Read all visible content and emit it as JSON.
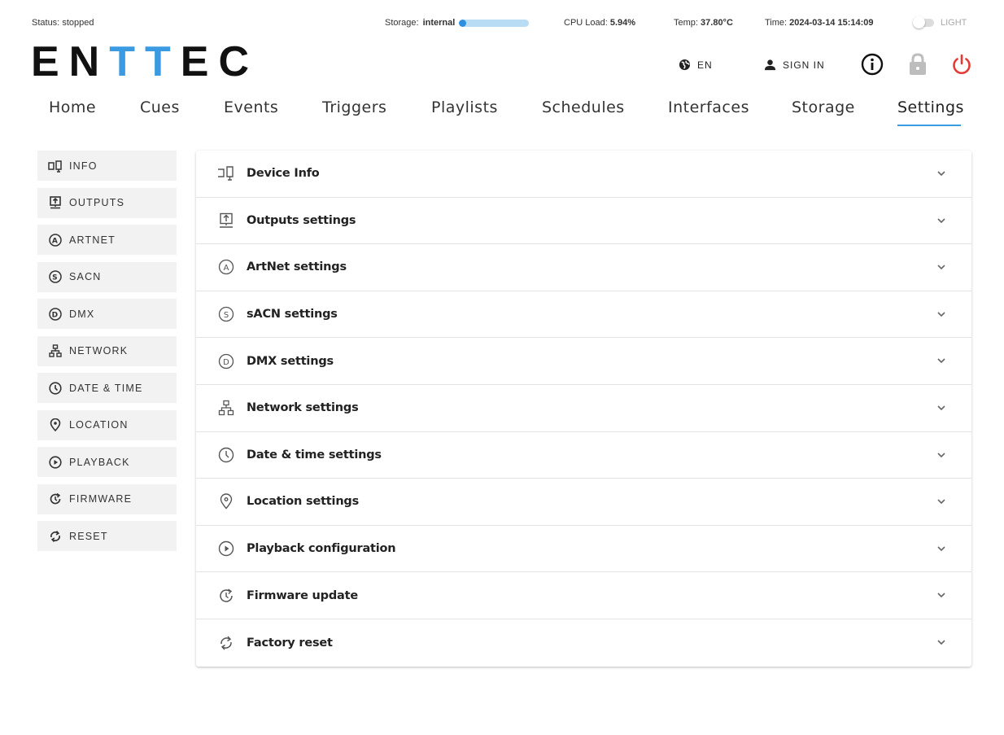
{
  "status_bar": {
    "status_label": "Status:",
    "status_value": "stopped",
    "storage_label": "Storage:",
    "storage_value": "internal",
    "storage_used_fraction": 0.1,
    "cpu_label": "CPU Load:",
    "cpu_value": "5.94%",
    "temp_label": "Temp:",
    "temp_value": "37.80°C",
    "time_label": "Time:",
    "time_value": "2024-03-14 15:14:09",
    "theme_label": "LIGHT"
  },
  "brand": {
    "part1": "EN",
    "part2": "TT",
    "part3": "EC"
  },
  "header": {
    "language": "EN",
    "sign_in": "SIGN IN",
    "icons": [
      "globe-icon",
      "person-icon",
      "info-icon",
      "lock-icon",
      "power-icon"
    ]
  },
  "nav": {
    "tabs": [
      {
        "label": "Home"
      },
      {
        "label": "Cues"
      },
      {
        "label": "Events"
      },
      {
        "label": "Triggers"
      },
      {
        "label": "Playlists"
      },
      {
        "label": "Schedules"
      },
      {
        "label": "Interfaces"
      },
      {
        "label": "Storage"
      },
      {
        "label": "Settings"
      }
    ],
    "active": "Settings"
  },
  "sidebar": {
    "items": [
      {
        "label": "INFO",
        "icon": "device-icon"
      },
      {
        "label": "OUTPUTS",
        "icon": "outputs-icon"
      },
      {
        "label": "ARTNET",
        "icon": "artnet-icon"
      },
      {
        "label": "SACN",
        "icon": "sacn-icon"
      },
      {
        "label": "DMX",
        "icon": "dmx-icon"
      },
      {
        "label": "NETWORK",
        "icon": "network-icon"
      },
      {
        "label": "DATE & TIME",
        "icon": "clock-icon"
      },
      {
        "label": "LOCATION",
        "icon": "location-icon"
      },
      {
        "label": "PLAYBACK",
        "icon": "play-icon"
      },
      {
        "label": "FIRMWARE",
        "icon": "update-icon"
      },
      {
        "label": "RESET",
        "icon": "reset-icon"
      }
    ]
  },
  "sections": {
    "items": [
      {
        "label": "Device Info",
        "icon": "device-icon"
      },
      {
        "label": "Outputs settings",
        "icon": "outputs-icon"
      },
      {
        "label": "ArtNet settings",
        "icon": "artnet-icon"
      },
      {
        "label": "sACN settings",
        "icon": "sacn-icon"
      },
      {
        "label": "DMX settings",
        "icon": "dmx-icon"
      },
      {
        "label": "Network settings",
        "icon": "network-icon"
      },
      {
        "label": "Date & time settings",
        "icon": "clock-icon"
      },
      {
        "label": "Location settings",
        "icon": "location-icon"
      },
      {
        "label": "Playback configuration",
        "icon": "play-icon"
      },
      {
        "label": "Firmware update",
        "icon": "update-icon"
      },
      {
        "label": "Factory reset",
        "icon": "reset-icon"
      }
    ]
  },
  "colors": {
    "accent": "#3b9be2",
    "power": "#e53935",
    "sidebar_bg": "#f2f2f2"
  }
}
